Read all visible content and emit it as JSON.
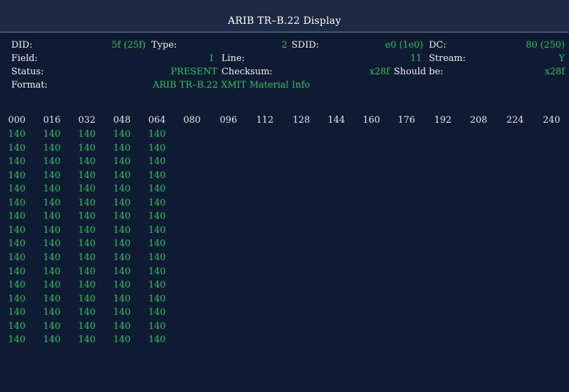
{
  "title": "ARIB TR–B.22 Display",
  "fields": {
    "did_label": "DID:",
    "did_value": "5f (25f)",
    "type_label": "Type:",
    "type_value": "2",
    "sdid_label": "SDID:",
    "sdid_value": "e0 (1e0)",
    "dc_label": "DC:",
    "dc_value": "80 (250)",
    "field_label": "Field:",
    "field_value": "1",
    "line_label": "Line:",
    "line_value": "11",
    "stream_label": "Stream:",
    "stream_value": "Y",
    "status_label": "Status:",
    "status_value": "PRESENT",
    "checksum_label": "Checksum:",
    "checksum_value": "x28f",
    "shouldbe_label": "Should be:",
    "shouldbe_value": "x28f",
    "format_label": "Format:",
    "format_value": "ARIB TR–B.22 XMIT Material Info"
  },
  "columns": [
    "000",
    "016",
    "032",
    "048",
    "064",
    "080",
    "096",
    "112",
    "128",
    "144",
    "160",
    "176",
    "192",
    "208",
    "224",
    "240"
  ],
  "rows": [
    [
      "140",
      "140",
      "140",
      "140",
      "140"
    ],
    [
      "140",
      "140",
      "140",
      "140",
      "140"
    ],
    [
      "140",
      "140",
      "140",
      "140",
      "140"
    ],
    [
      "140",
      "140",
      "140",
      "140",
      "140"
    ],
    [
      "140",
      "140",
      "140",
      "140",
      "140"
    ],
    [
      "140",
      "140",
      "140",
      "140",
      "140"
    ],
    [
      "140",
      "140",
      "140",
      "140",
      "140"
    ],
    [
      "140",
      "140",
      "140",
      "140",
      "140"
    ],
    [
      "140",
      "140",
      "140",
      "140",
      "140"
    ],
    [
      "140",
      "140",
      "140",
      "140",
      "140"
    ],
    [
      "140",
      "140",
      "140",
      "140",
      "140"
    ],
    [
      "140",
      "140",
      "140",
      "140",
      "140"
    ],
    [
      "140",
      "140",
      "140",
      "140",
      "140"
    ],
    [
      "140",
      "140",
      "140",
      "140",
      "140"
    ],
    [
      "140",
      "140",
      "140",
      "140",
      "140"
    ],
    [
      "140",
      "140",
      "140",
      "140",
      "140"
    ]
  ]
}
